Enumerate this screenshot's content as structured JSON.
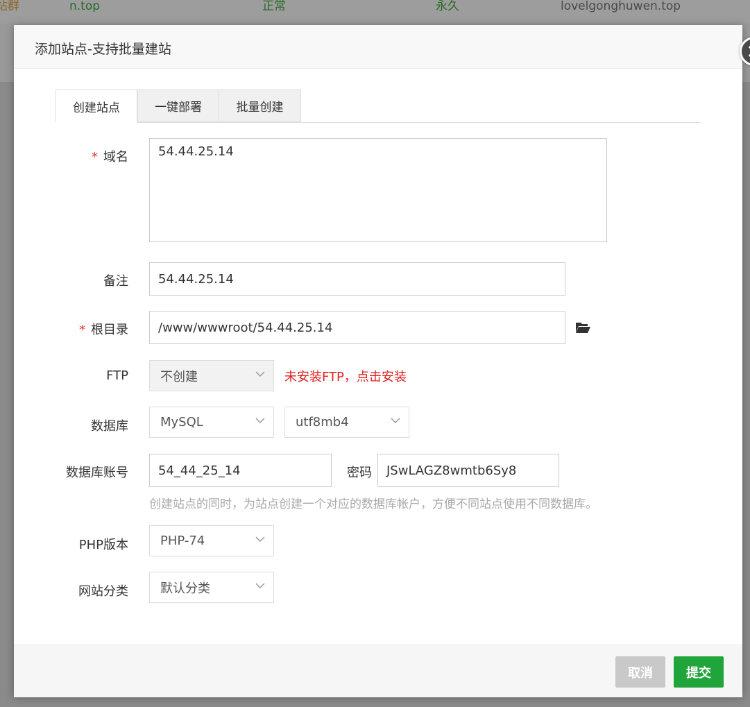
{
  "background": {
    "item_a": "站群",
    "item_b": "n.top",
    "item_c": "正常",
    "item_d": "永久",
    "item_e": "lovelgonghuwen.top"
  },
  "dialog": {
    "title": "添加站点-支持批量建站",
    "tabs": [
      {
        "label": "创建站点",
        "active": true
      },
      {
        "label": "一键部署",
        "active": false
      },
      {
        "label": "批量创建",
        "active": false
      }
    ]
  },
  "form": {
    "required_mark": "*",
    "domain": {
      "label": "域名",
      "value": "54.44.25.14"
    },
    "remark": {
      "label": "备注",
      "value": "54.44.25.14"
    },
    "root": {
      "label": "根目录",
      "value": "/www/wwwroot/54.44.25.14"
    },
    "ftp": {
      "label": "FTP",
      "selected": "不创建",
      "warning": "未安装FTP，点击安装"
    },
    "database": {
      "label": "数据库",
      "type_selected": "MySQL",
      "charset_selected": "utf8mb4"
    },
    "db_account": {
      "label": "数据库账号",
      "value": "54_44_25_14",
      "password_label": "密码",
      "password_value": "JSwLAGZ8wmtb6Sy8",
      "hint": "创建站点的同时，为站点创建一个对应的数据库帐户，方便不同站点使用不同数据库。"
    },
    "php": {
      "label": "PHP版本",
      "selected": "PHP-74"
    },
    "category": {
      "label": "网站分类",
      "selected": "默认分类"
    }
  },
  "footer": {
    "cancel_label": "取消",
    "submit_label": "提交"
  },
  "colors": {
    "accent_green": "#20a53a",
    "warning_red": "#e02020",
    "required_red": "#e53935"
  }
}
